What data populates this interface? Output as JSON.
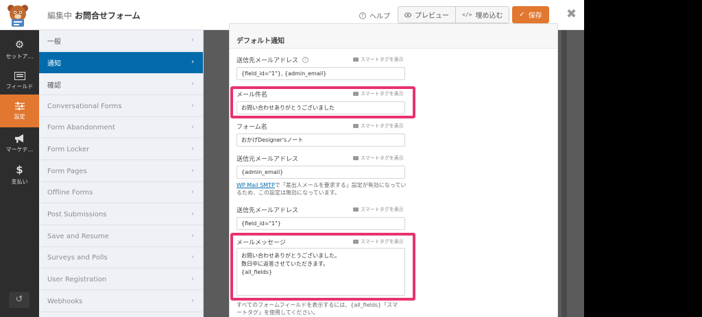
{
  "header": {
    "editing_label": "編集中",
    "form_name": "お問合せフォーム",
    "help_label": "ヘルプ",
    "preview_label": "プレビュー",
    "embed_label": "埋め込む",
    "save_label": "保存",
    "close_glyph": "✖"
  },
  "icon_nav": [
    {
      "label": "セットア…",
      "icon": "gear-icon"
    },
    {
      "label": "フィールド",
      "icon": "fields-icon"
    },
    {
      "label": "設定",
      "icon": "sliders-icon"
    },
    {
      "label": "マーケテ…",
      "icon": "megaphone-icon"
    },
    {
      "label": "支払い",
      "icon": "dollar-icon"
    }
  ],
  "panel": {
    "items": [
      {
        "label": "一般"
      },
      {
        "label": "通知"
      },
      {
        "label": "確認"
      },
      {
        "label": "Conversational Forms"
      },
      {
        "label": "Form Abandonment"
      },
      {
        "label": "Form Locker"
      },
      {
        "label": "Form Pages"
      },
      {
        "label": "Offline Forms"
      },
      {
        "label": "Post Submissions"
      },
      {
        "label": "Save and Resume"
      },
      {
        "label": "Surveys and Polls"
      },
      {
        "label": "User Registration"
      },
      {
        "label": "Webhooks"
      }
    ]
  },
  "notification": {
    "title": "デフォルト通知",
    "smart_tag_label": "スマートタグを表示",
    "send_to": {
      "label": "送信先メールアドレス",
      "value": "{field_id=\"1\"}, {admin_email}"
    },
    "subject": {
      "label": "メール件名",
      "value": "お問い合わせありがとうございました"
    },
    "from_name": {
      "label": "フォーム名",
      "value": "おかげDesigner'sノート"
    },
    "from_email": {
      "label": "送信元メールアドレス",
      "value": "{admin_email}"
    },
    "smtp_note_link": "WP Mail SMTP",
    "smtp_note_1": "で「差出人メールを要求する」設定が有効になってい",
    "smtp_note_2": "るため、この設定は無効になっています。",
    "reply_to": {
      "label": "送信先メールアドレス",
      "value": "{field_id=\"1\"}"
    },
    "message": {
      "label": "メールメッセージ",
      "lines": [
        "お問い合わせありがとうございました。",
        "数日中に返答させていただきます。",
        "{all_fields}"
      ]
    },
    "footer_1": "すべてのフォームフィールドを表示するには、{all_fields}「スマ",
    "footer_2": "ートタグ」を使用してください。"
  },
  "colors": {
    "accent": "#e27730",
    "active_blue": "#036aab",
    "highlight": "#e8336d"
  }
}
